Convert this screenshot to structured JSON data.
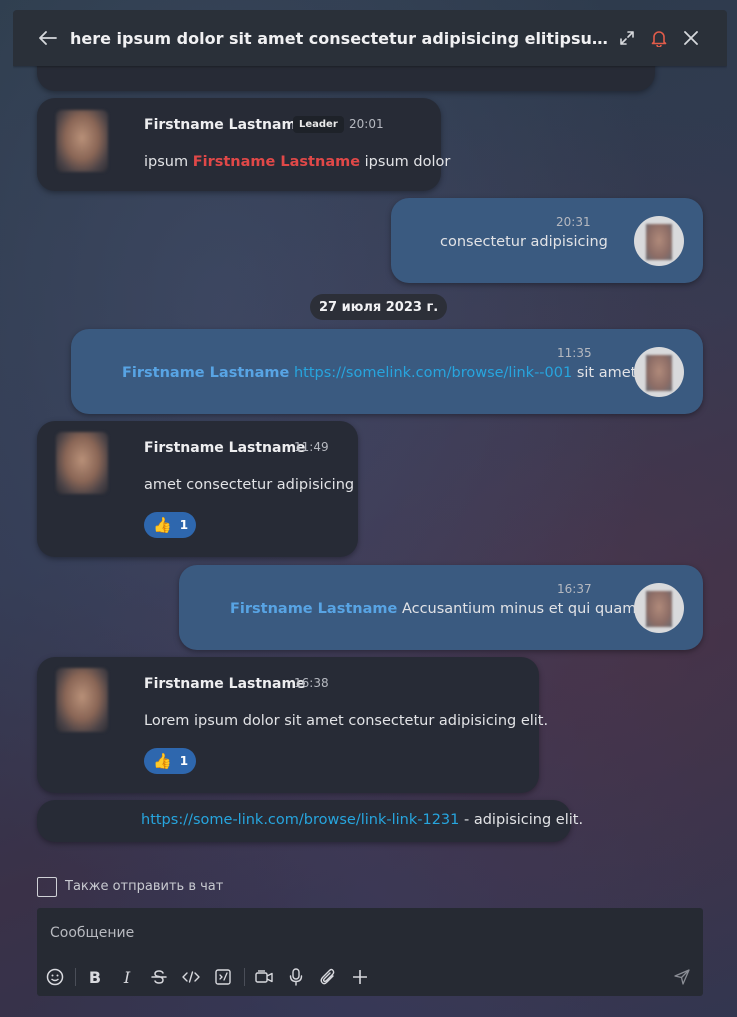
{
  "header": {
    "title": "here ipsum dolor sit amet consectetur adipisicing elitipsum dolor sit amet consectetur"
  },
  "messages": [
    {
      "sender": "Firstname Lastname",
      "badge": "Leader",
      "time": "20:01",
      "text_before": "ipsum",
      "mention": "Firstname Lastname",
      "text_after": "ipsum dolor"
    },
    {
      "time": "20:31",
      "text": "consectetur adipisicing"
    },
    {
      "date_separator": "27 июля 2023 г."
    },
    {
      "time": "11:35",
      "mention": "Firstname Lastname",
      "link": "https://somelink.com/browse/link--001",
      "text_after": "sit amet"
    },
    {
      "sender": "Firstname Lastname",
      "time": "11:49",
      "text": "amet consectetur adipisicing",
      "reaction": {
        "emoji": "👍",
        "count": "1"
      }
    },
    {
      "time": "16:37",
      "mention": "Firstname Lastname",
      "text": "Accusantium minus et qui quam"
    },
    {
      "sender": "Firstname Lastname",
      "time": "16:38",
      "text": "Lorem ipsum dolor sit amet consectetur adipisicing elit.",
      "reaction": {
        "emoji": "👍",
        "count": "1"
      }
    },
    {
      "link": "https://some-link.com/browse/link-link-1231",
      "text_after": " - adipisicing elit."
    }
  ],
  "composer": {
    "also_send_label": "Также отправить в чат",
    "placeholder": "Сообщение"
  },
  "icons": {
    "back": "arrow-left-icon",
    "expand": "expand-icon",
    "bell": "bell-icon",
    "close": "close-icon",
    "emoji": "smiley-icon",
    "bold": "bold-icon",
    "italic": "italic-icon",
    "strike": "strikethrough-icon",
    "code": "code-icon",
    "code_block": "code-block-icon",
    "video": "video-icon",
    "mic": "microphone-icon",
    "attach": "paperclip-icon",
    "add": "plus-icon",
    "send": "send-icon"
  },
  "colors": {
    "incoming_bubble": "#272b36",
    "outgoing_bubble": "#3a5a80",
    "mention_red": "#e04848",
    "mention_blue": "#58a4e4",
    "link": "#27a5de",
    "bell_accent": "#e25c4a",
    "reaction": "#2e67ae"
  }
}
